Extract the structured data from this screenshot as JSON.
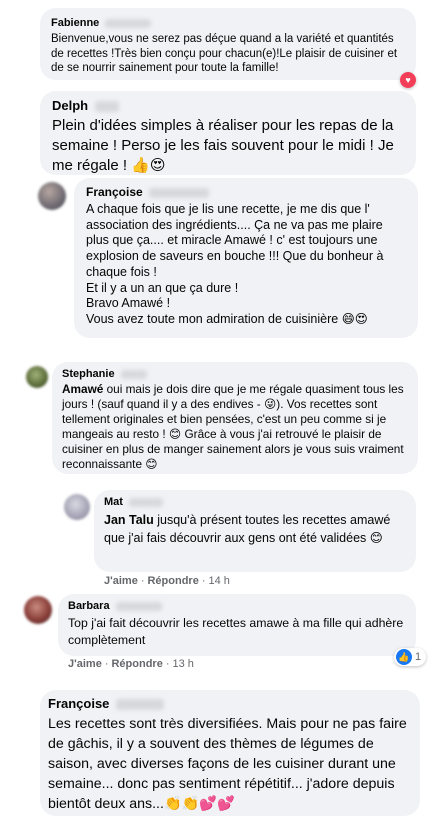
{
  "comments": [
    {
      "author": "Fabienne",
      "text": "Bienvenue,vous ne serez pas déçue quand a la variété et quantités de recettes !Très bien conçu pour chacun(e)!Le plaisir de cuisiner et de se nourrir sainement pour toute la famille!"
    },
    {
      "author": "Delph",
      "text": "Plein d'idées simples à réaliser pour les repas de la semaine ! Perso je les fais souvent pour le midi ! Je me régale ! 👍😍"
    },
    {
      "author": "Françoise",
      "text": "A chaque fois que je lis une recette, je me dis que l' association des ingrédients.... Ça ne va pas me plaire plus que ça.... et miracle Amawé ! c' est toujours une explosion de saveurs en bouche !!! Que du bonheur à chaque fois !\nEt il y a un an que ça dure !\nBravo Amawé !\nVous avez toute mon admiration de cuisinière 😄😍"
    },
    {
      "author": "Stephanie",
      "mention": "Amawé",
      "text": " oui mais je dois dire que je me régale quasiment tous les jours ! (sauf quand il y a des endives - 😜). Vos recettes sont tellement originales et bien pensées, c'est un peu comme si je mangeais au resto ! 😊 Grâce à vous j'ai retrouvé le plaisir de cuisiner en plus de manger sainement alors je vous suis vraiment reconnaissante 😊"
    },
    {
      "author": "Mat",
      "mention": "Jan Talu",
      "text": " jusqu'à présent toutes les recettes amawé que j'ai fais découvrir aux gens ont été validées 😊",
      "like_label": "J'aime",
      "reply_label": "Répondre",
      "time": "14 h"
    },
    {
      "author": "Barbara",
      "text": "Top j'ai fait découvrir les recettes amawe à ma fille qui adhère complètement",
      "like_label": "J'aime",
      "reply_label": "Répondre",
      "time": "13 h",
      "reaction_count": "1"
    },
    {
      "author": "Françoise",
      "text": "Les recettes sont très diversifiées. Mais pour ne pas faire de gâchis, il y a souvent des thèmes de légumes de saison, avec diverses façons de les cuisiner durant une semaine... donc pas sentiment répétitif... j'adore depuis bientôt deux ans...👏👏💕💕"
    }
  ],
  "colors": {
    "bubble": "#f0f2f5",
    "meta": "#65676b",
    "like_blue": "#1877f2",
    "heart_red": "#f33e58"
  }
}
